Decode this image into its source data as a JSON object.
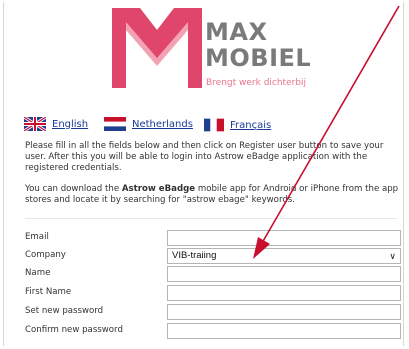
{
  "brand": {
    "line1": "MAX",
    "line2": "MOBIEL",
    "tagline": "Brengt werk dichterbij",
    "primary_color": "#e0456b",
    "secondary_color": "#f3a2b4",
    "text_color": "#7a7a7a"
  },
  "languages": [
    {
      "label": "English",
      "flag": "uk-flag-icon"
    },
    {
      "label": "Netherlands",
      "flag": "netherlands-flag-icon"
    },
    {
      "label": "Français",
      "flag": "france-flag-icon"
    }
  ],
  "intro": {
    "text": "Please fill in all the fields below and then click on Register user button to save your user. After this you will be able to login into Astrow eBadge application with the registered credentials.",
    "download_pre": "You can download the ",
    "download_app": "Astrow eBadge",
    "download_post": " mobile app for Android or iPhone from the app stores and locate it by searching for \"astrow ebage\" keywords."
  },
  "form": {
    "email_label": "Email",
    "email_value": "",
    "company_label": "Company",
    "company_value": "VIB-traiing",
    "name_label": "Name",
    "name_value": "",
    "first_name_label": "First Name",
    "first_name_value": "",
    "new_password_label": "Set new password",
    "confirm_password_label": "Confirm new password"
  },
  "annotation": {
    "arrow_color": "#c8102e"
  }
}
